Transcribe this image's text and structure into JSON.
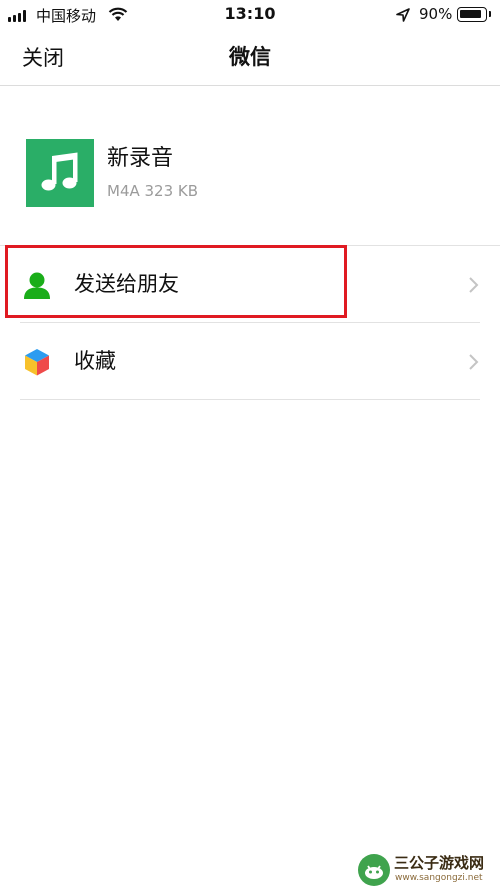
{
  "status_bar": {
    "carrier": "中国移动",
    "time": "13:10",
    "battery_percent": "90%",
    "battery_level": 0.9
  },
  "nav": {
    "close_label": "关闭",
    "title": "微信"
  },
  "file": {
    "name": "新录音",
    "meta": "M4A 323 KB",
    "thumb_color": "#2aae67",
    "thumb_icon": "music-note-icon"
  },
  "actions": [
    {
      "label": "发送给朋友",
      "icon": "user-icon",
      "icon_color": "#1aad19",
      "highlighted": true
    },
    {
      "label": "收藏",
      "icon": "cube-icon"
    }
  ],
  "watermark": {
    "title": "三公子游戏网",
    "url": "www.sangongzi.net"
  },
  "colors": {
    "highlight": "#e01a22",
    "separator": "#e2e2e2",
    "meta_text": "#9b9b9b"
  }
}
